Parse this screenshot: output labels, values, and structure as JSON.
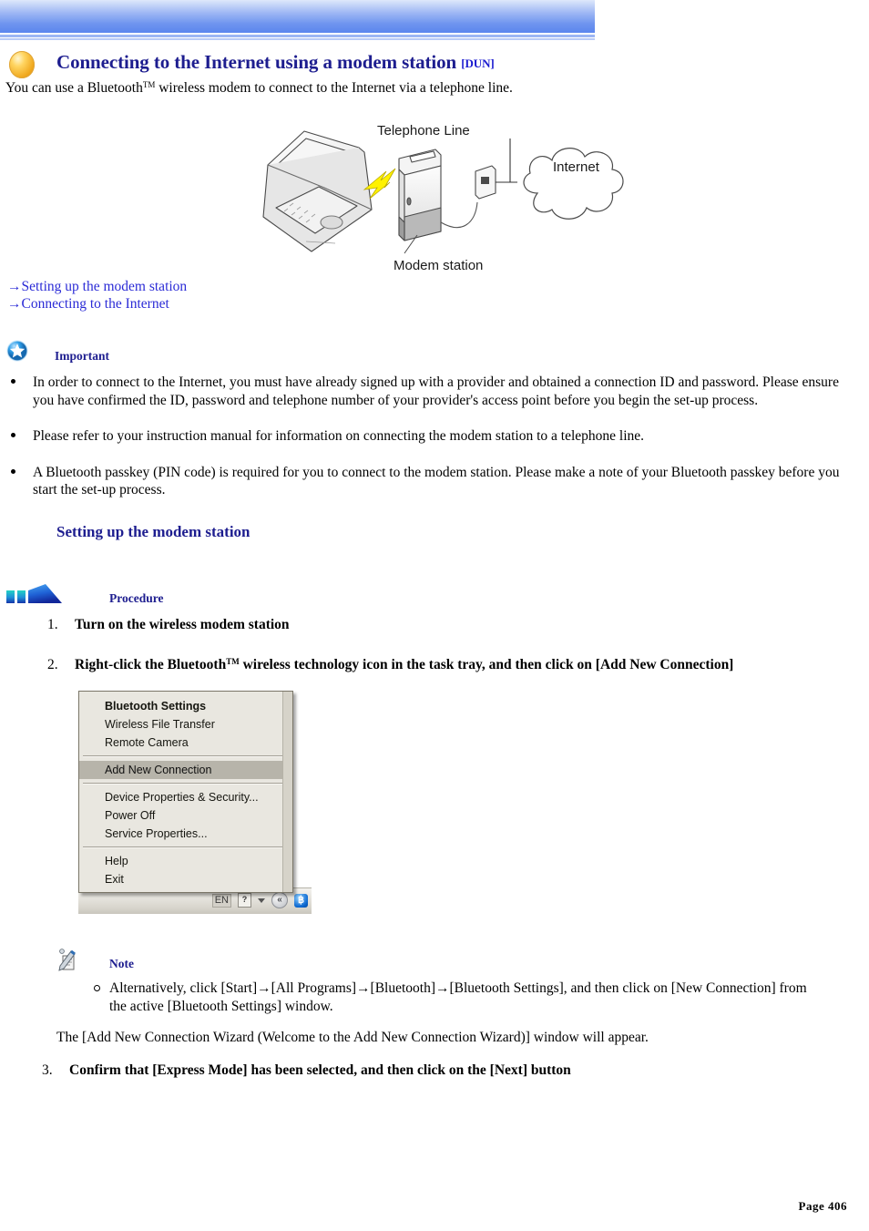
{
  "header": {
    "banner_color_top": "#dfe8fb",
    "banner_color_bottom": "#5b86ee"
  },
  "title": {
    "icon": "orange-sphere-icon",
    "text": "Connecting to the Internet using a modem station ",
    "tag": "[DUN]",
    "accent_color": "#1d1d8f"
  },
  "intro": {
    "part1": "You can use a Bluetooth",
    "trademark": "TM",
    "part2": " wireless modem to connect to the Internet via a telephone line."
  },
  "diagram": {
    "labels": {
      "telephone_line": "Telephone Line",
      "internet": "Internet",
      "modem_station": "Modem station"
    }
  },
  "links": [
    {
      "arrow": "→",
      "label": "Setting up the modem station"
    },
    {
      "arrow": "→",
      "label": "Connecting to the Internet"
    }
  ],
  "important": {
    "icon": "blue-star-icon",
    "label": "Important",
    "bullets": [
      "In order to connect to the Internet, you must have already signed up with a provider and obtained a connection ID and password. Please ensure you have confirmed the ID, password and telephone number of your provider's access point before you begin the set-up process.",
      "Please refer to your instruction manual for information on connecting the modem station to a telephone line.",
      "A Bluetooth passkey (PIN code) is required for you to connect to the modem station. Please make a note of your Bluetooth passkey before you start the set-up process."
    ]
  },
  "section": {
    "heading": "Setting up the modem station"
  },
  "procedure": {
    "icon": "blue-arrow-bars-icon",
    "label": "Procedure",
    "steps": [
      {
        "num": "1.",
        "text": "Turn on the wireless modem station"
      },
      {
        "num": "2.",
        "text_pre": "Right-click the Bluetooth",
        "trademark": "TM",
        "text_post": " wireless technology icon in the task tray, and then click on [Add New Connection]"
      },
      {
        "num": "3.",
        "text": "Confirm that [Express Mode] has been selected, and then click on the [Next] button"
      }
    ]
  },
  "context_menu": {
    "items": [
      {
        "label": "Bluetooth Settings",
        "bold": true,
        "selected": false
      },
      {
        "label": "Wireless File Transfer",
        "bold": false,
        "selected": false
      },
      {
        "label": "Remote Camera",
        "bold": false,
        "selected": false
      },
      {
        "label": "Add New Connection",
        "bold": false,
        "selected": true
      },
      {
        "label": "Device Properties & Security...",
        "bold": false,
        "selected": false
      },
      {
        "label": "Power Off",
        "bold": false,
        "selected": false
      },
      {
        "label": "Service Properties...",
        "bold": false,
        "selected": false
      },
      {
        "label": "Help",
        "bold": false,
        "selected": false
      },
      {
        "label": "Exit",
        "bold": false,
        "selected": false
      }
    ],
    "tray": {
      "language": "EN",
      "help": "?",
      "caret": "caret-down-icon",
      "back": "«",
      "bluetooth": "฿"
    }
  },
  "note": {
    "icon": "pencil-note-icon",
    "label": "Note",
    "bullet": "Alternatively, click [Start]→[All Programs]→[Bluetooth]→[Bluetooth Settings], and then click on [New Connection] from the active [Bluetooth Settings] window.",
    "after": "The [Add New Connection Wizard (Welcome to the Add New Connection Wizard)] window will appear."
  },
  "footer": {
    "page": "Page 406"
  }
}
